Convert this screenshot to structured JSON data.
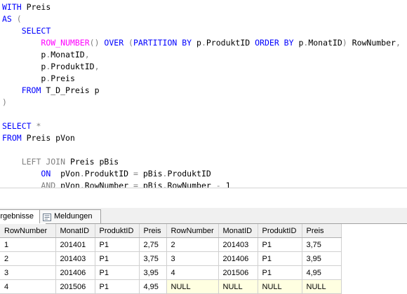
{
  "editor": {
    "lines": [
      [
        {
          "c": "kw",
          "t": "WITH "
        },
        {
          "c": "txt",
          "t": "Preis"
        }
      ],
      [
        {
          "c": "kw",
          "t": "AS "
        },
        {
          "c": "gray",
          "t": "("
        }
      ],
      [
        {
          "c": "txt",
          "t": "    "
        },
        {
          "c": "kw",
          "t": "SELECT"
        }
      ],
      [
        {
          "c": "txt",
          "t": "        "
        },
        {
          "c": "fn",
          "t": "ROW_NUMBER"
        },
        {
          "c": "gray",
          "t": "() "
        },
        {
          "c": "kw",
          "t": "OVER "
        },
        {
          "c": "gray",
          "t": "("
        },
        {
          "c": "kw",
          "t": "PARTITION BY "
        },
        {
          "c": "txt",
          "t": "p"
        },
        {
          "c": "gray",
          "t": "."
        },
        {
          "c": "txt",
          "t": "ProduktID "
        },
        {
          "c": "kw",
          "t": "ORDER BY "
        },
        {
          "c": "txt",
          "t": "p"
        },
        {
          "c": "gray",
          "t": "."
        },
        {
          "c": "txt",
          "t": "MonatID"
        },
        {
          "c": "gray",
          "t": ") "
        },
        {
          "c": "txt",
          "t": "RowNumber"
        },
        {
          "c": "gray",
          "t": ","
        }
      ],
      [
        {
          "c": "txt",
          "t": "        p"
        },
        {
          "c": "gray",
          "t": "."
        },
        {
          "c": "txt",
          "t": "MonatID"
        },
        {
          "c": "gray",
          "t": ","
        }
      ],
      [
        {
          "c": "txt",
          "t": "        p"
        },
        {
          "c": "gray",
          "t": "."
        },
        {
          "c": "txt",
          "t": "ProduktID"
        },
        {
          "c": "gray",
          "t": ","
        }
      ],
      [
        {
          "c": "txt",
          "t": "        p"
        },
        {
          "c": "gray",
          "t": "."
        },
        {
          "c": "txt",
          "t": "Preis"
        }
      ],
      [
        {
          "c": "txt",
          "t": "    "
        },
        {
          "c": "kw",
          "t": "FROM "
        },
        {
          "c": "txt",
          "t": "T_D_Preis p"
        }
      ],
      [
        {
          "c": "gray",
          "t": ")"
        }
      ],
      [],
      [
        {
          "c": "kw",
          "t": "SELECT "
        },
        {
          "c": "gray",
          "t": "*"
        }
      ],
      [
        {
          "c": "kw",
          "t": "FROM "
        },
        {
          "c": "txt",
          "t": "Preis pVon"
        }
      ],
      [],
      [
        {
          "c": "txt",
          "t": "    "
        },
        {
          "c": "gray",
          "t": "LEFT JOIN "
        },
        {
          "c": "txt",
          "t": "Preis pBis"
        }
      ],
      [
        {
          "c": "txt",
          "t": "        "
        },
        {
          "c": "kw",
          "t": "ON  "
        },
        {
          "c": "txt",
          "t": "pVon"
        },
        {
          "c": "gray",
          "t": "."
        },
        {
          "c": "txt",
          "t": "ProduktID "
        },
        {
          "c": "gray",
          "t": "= "
        },
        {
          "c": "txt",
          "t": "pBis"
        },
        {
          "c": "gray",
          "t": "."
        },
        {
          "c": "txt",
          "t": "ProduktID"
        }
      ],
      [
        {
          "c": "txt",
          "t": "        "
        },
        {
          "c": "gray",
          "t": "AND "
        },
        {
          "c": "txt",
          "t": "pVon"
        },
        {
          "c": "gray",
          "t": "."
        },
        {
          "c": "txt",
          "t": "RowNumber "
        },
        {
          "c": "gray",
          "t": "= "
        },
        {
          "c": "txt",
          "t": "pBis"
        },
        {
          "c": "gray",
          "t": "."
        },
        {
          "c": "txt",
          "t": "RowNumber "
        },
        {
          "c": "gray",
          "t": "- "
        },
        {
          "c": "txt",
          "t": "1"
        }
      ]
    ]
  },
  "tabs": {
    "results_label": "Ergebnisse",
    "messages_label": "Meldungen",
    "results_icon": "grid-icon",
    "messages_icon": "message-icon"
  },
  "grid": {
    "columns": [
      "RowNumber",
      "MonatID",
      "ProduktID",
      "Preis",
      "RowNumber",
      "MonatID",
      "ProduktID",
      "Preis"
    ],
    "rows": [
      [
        "1",
        "201401",
        "P1",
        "2,75",
        "2",
        "201403",
        "P1",
        "3,75"
      ],
      [
        "2",
        "201403",
        "P1",
        "3,75",
        "3",
        "201406",
        "P1",
        "3,95"
      ],
      [
        "3",
        "201406",
        "P1",
        "3,95",
        "4",
        "201506",
        "P1",
        "4,95"
      ],
      [
        "4",
        "201506",
        "P1",
        "4,95",
        "NULL",
        "NULL",
        "NULL",
        "NULL"
      ]
    ]
  },
  "colors": {
    "keyword": "#0000ff",
    "function": "#ff00ff",
    "operator": "#808080",
    "null_cell": "#ffffe1"
  }
}
